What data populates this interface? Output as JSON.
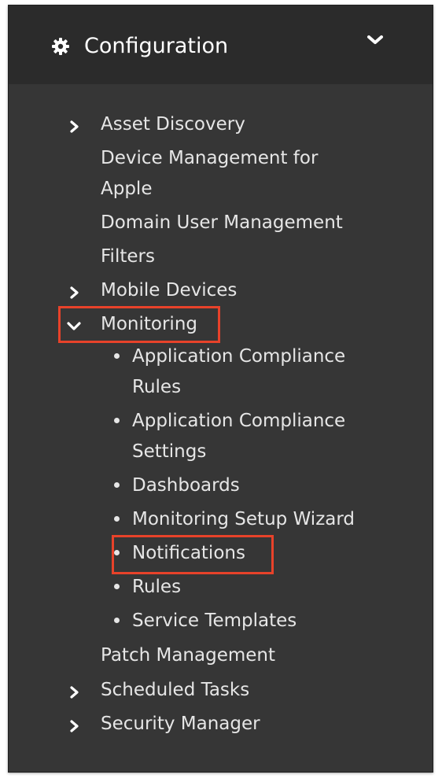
{
  "header": {
    "title": "Configuration",
    "icon": "gear-icon",
    "toggle_icon": "chevron-down-icon"
  },
  "menu": {
    "asset_discovery": "Asset Discovery",
    "device_management_line1": "Device Management for",
    "device_management_line2": "Apple",
    "domain_user_management": "Domain User Management",
    "filters": "Filters",
    "mobile_devices": "Mobile Devices",
    "monitoring": "Monitoring",
    "patch_management": "Patch Management",
    "scheduled_tasks": "Scheduled Tasks",
    "security_manager": "Security Manager"
  },
  "monitoring_items": {
    "app_compliance_rules_line1": "Application Compliance",
    "app_compliance_rules_line2": "Rules",
    "app_compliance_settings_line1": "Application Compliance",
    "app_compliance_settings_line2": "Settings",
    "dashboards": "Dashboards",
    "monitoring_setup_wizard": "Monitoring Setup Wizard",
    "notifications": "Notifications",
    "rules": "Rules",
    "service_templates": "Service Templates"
  },
  "colors": {
    "panel_bg": "#363636",
    "header_bg": "#2b2b2b",
    "text": "#e6e6e6",
    "highlight": "#e8422a"
  }
}
